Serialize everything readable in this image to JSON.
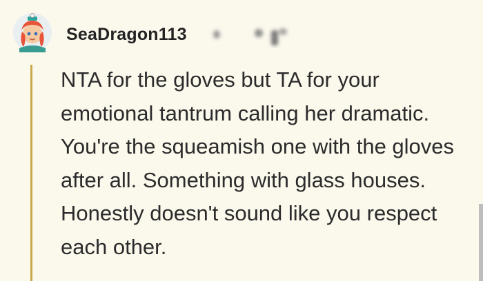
{
  "comment": {
    "author": "SeaDragon113",
    "body": "NTA for the gloves but TA for your emotional tantrum calling her dramatic. You're the squeamish one with the gloves after all. Something with glass houses. Honestly doesn't sound like you respect each other."
  },
  "icons": {
    "avatar": "avatar-icon",
    "meta": "blurred-meta-icons"
  },
  "colors": {
    "background": "#fbf8ec",
    "thread_line": "#c9a84a",
    "text": "#2b2b2b"
  }
}
